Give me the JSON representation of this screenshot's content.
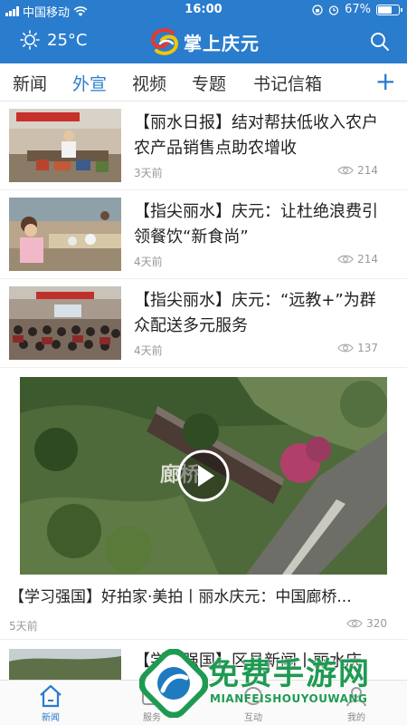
{
  "status_bar": {
    "carrier": "中国移动",
    "time": "16:00",
    "battery": "67%",
    "battery_level": 0.67
  },
  "header": {
    "temperature": "25°C",
    "brand": "掌上庆元",
    "weather_icon": "sun-icon",
    "search_icon": "search-icon"
  },
  "tabs": [
    {
      "label": "新闻",
      "active": false
    },
    {
      "label": "外宣",
      "active": true
    },
    {
      "label": "视频",
      "active": false
    },
    {
      "label": "专题",
      "active": false
    },
    {
      "label": "书记信箱",
      "active": false
    }
  ],
  "tab_add": "+",
  "feed": [
    {
      "title": "【丽水日报】结对帮扶低收入农户 农产品销售点助农增收",
      "time": "3天前",
      "views": "214"
    },
    {
      "title": "【指尖丽水】庆元：让杜绝浪费引领餐饮“新食尚”",
      "time": "4天前",
      "views": "214"
    },
    {
      "title": "【指尖丽水】庆元：“远教+”为群众配送多元服务",
      "time": "4天前",
      "views": "137"
    }
  ],
  "video": {
    "title": "【学习强国】好拍家·美拍丨丽水庆元：中国廊桥...",
    "time": "5天前",
    "views": "320",
    "overlay_text": "廊桥"
  },
  "partial_item": {
    "title": "【学习强国】区县新闻丨丽水庆"
  },
  "bottom_nav": [
    {
      "label": "新闻",
      "icon": "home-icon",
      "active": true
    },
    {
      "label": "服务",
      "icon": "service-icon",
      "active": false
    },
    {
      "label": "互动",
      "icon": "interact-icon",
      "active": false
    },
    {
      "label": "我的",
      "icon": "profile-icon",
      "active": false
    }
  ],
  "watermark": {
    "title": "免费手游网",
    "subtitle": "MIANFEISHOUYOUWANG"
  },
  "colors": {
    "brand_blue": "#2a7ccd",
    "watermark_green": "#1f9a52"
  }
}
